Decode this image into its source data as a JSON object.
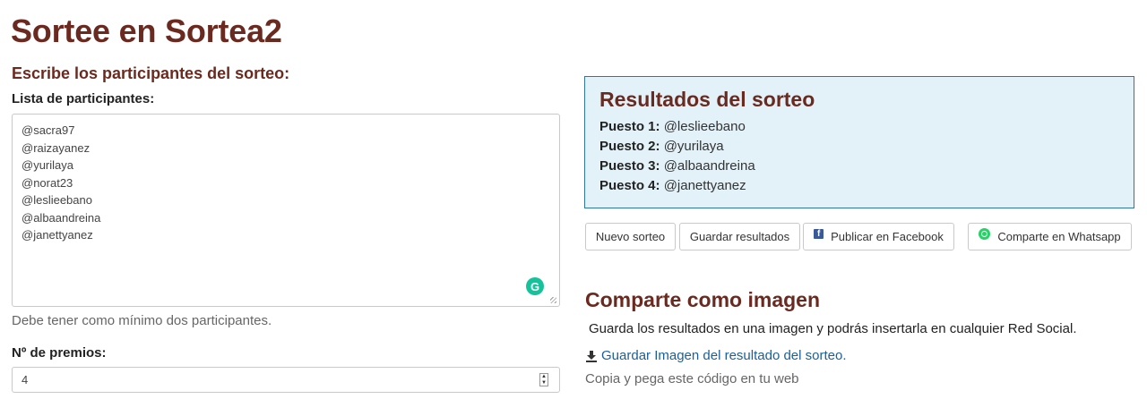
{
  "page": {
    "title": "Sortee en Sortea2",
    "subtitle": "Escribe los participantes del sorteo:"
  },
  "participants": {
    "label": "Lista de participantes:",
    "items": [
      "@sacra97",
      "@raizayanez",
      "@yurilaya",
      "@norat23",
      "@leslieebano",
      "@albaandreina",
      "@janettyanez"
    ],
    "help": "Debe tener como mínimo dos participantes."
  },
  "prizes": {
    "label": "Nº de premios:",
    "value": "4"
  },
  "results": {
    "title": "Resultados del sorteo",
    "rows": [
      {
        "label": "Puesto 1:",
        "value": "@leslieebano"
      },
      {
        "label": "Puesto 2:",
        "value": "@yurilaya"
      },
      {
        "label": "Puesto 3:",
        "value": "@albaandreina"
      },
      {
        "label": "Puesto 4:",
        "value": "@janettyanez"
      }
    ]
  },
  "actions": {
    "new_draw": "Nuevo sorteo",
    "save_results": "Guardar resultados",
    "facebook": "Publicar en Facebook",
    "whatsapp": "Comparte en Whatsapp"
  },
  "share": {
    "title": "Comparte como imagen",
    "description": "Guarda los resultados en una imagen y podrás insertarla en cualquier Red Social.",
    "download_link": "Guardar Imagen del resultado del sorteo.",
    "embed_text": "Copia y pega este código en tu web"
  },
  "icons": {
    "facebook": "facebook-icon",
    "whatsapp": "whatsapp-icon",
    "download": "download-icon",
    "grammarly": "grammarly-icon"
  },
  "colors": {
    "heading": "#6b2a20",
    "results_bg": "#e3f2f8",
    "results_border": "#2f76a8",
    "link": "#1b5f98"
  }
}
